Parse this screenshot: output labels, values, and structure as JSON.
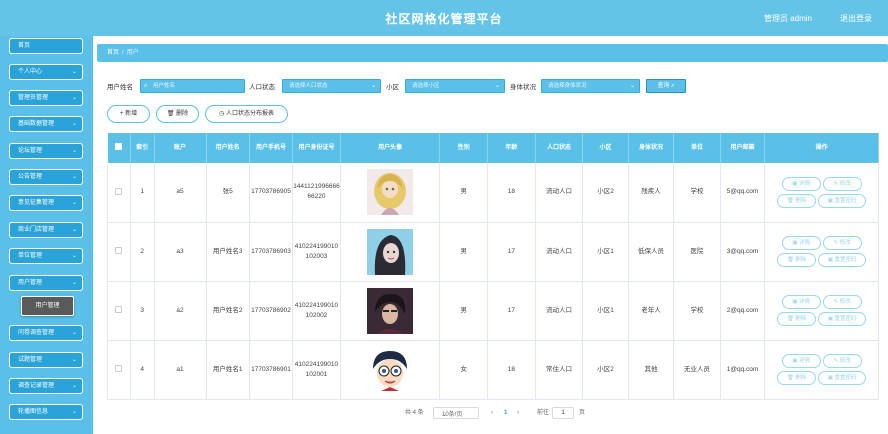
{
  "header": {
    "title": "社区网格化管理平台",
    "admin_label": "管理员 admin",
    "logout": "退出登录"
  },
  "sidebar": {
    "items": [
      "首页",
      "个人中心",
      "管理员管理",
      "基础数据管理",
      "论坛管理",
      "公告管理",
      "意见征集管理",
      "商业门店管理",
      "单位管理",
      "用户管理",
      "问卷调查管理",
      "试题管理",
      "调查记录管理",
      "轮播图信息"
    ],
    "submenu": "用户管理"
  },
  "breadcrumb": {
    "home": "首页",
    "sep": "/",
    "current": "用户"
  },
  "filters": {
    "name_label": "用户姓名",
    "name_placeholder": "用户姓名",
    "status_label": "人口状态",
    "status_placeholder": "请选择人口状态",
    "area_label": "小区",
    "area_placeholder": "请选择小区",
    "health_label": "身体状况",
    "health_placeholder": "请选择身体状况",
    "query": "查询"
  },
  "actions": {
    "add": "新增",
    "delete": "删除",
    "report": "人口状态分布报表"
  },
  "table": {
    "headers": [
      "索引",
      "账户",
      "用户姓名",
      "用户手机号",
      "用户身份证号",
      "用户头像",
      "性别",
      "年龄",
      "人口状态",
      "小区",
      "身体状况",
      "单位",
      "用户邮箱",
      "操作"
    ],
    "rows": [
      {
        "index": "1",
        "account": "a5",
        "name": "张5",
        "phone": "17703786905",
        "idcard": "144112199666666220",
        "gender": "男",
        "age": "18",
        "status": "流动人口",
        "area": "小区2",
        "health": "残疾人",
        "unit": "学校",
        "email": "5@qq.com",
        "avatar": "blonde-girl-avatar"
      },
      {
        "index": "2",
        "account": "a3",
        "name": "用户姓名3",
        "phone": "17703786903",
        "idcard": "410224199010102003",
        "gender": "男",
        "age": "17",
        "status": "流动人口",
        "area": "小区1",
        "health": "低保人员",
        "unit": "医院",
        "email": "3@qq.com",
        "avatar": "dark-hair-girl-avatar"
      },
      {
        "index": "3",
        "account": "a2",
        "name": "用户姓名2",
        "phone": "17703786902",
        "idcard": "410224199010102002",
        "gender": "男",
        "age": "17",
        "status": "流动人口",
        "area": "小区1",
        "health": "老年人",
        "unit": "学校",
        "email": "2@qq.com",
        "avatar": "boy-dark-avatar"
      },
      {
        "index": "4",
        "account": "a1",
        "name": "用户姓名1",
        "phone": "17703786901",
        "idcard": "410224199010102001",
        "gender": "女",
        "age": "18",
        "status": "常住人口",
        "area": "小区2",
        "health": "其他",
        "unit": "无业人员",
        "email": "1@qq.com",
        "avatar": "cartoon-boy-avatar"
      }
    ],
    "ops": {
      "detail": "详情",
      "edit": "修改",
      "delete": "删除",
      "reset": "重置密码"
    }
  },
  "pagination": {
    "total": "共 4 条",
    "page_size": "10条/页",
    "prev": "‹",
    "current_page": "1",
    "next": "›",
    "goto_label": "前往",
    "goto_value": "1",
    "page_suffix": "页"
  },
  "colors": {
    "header": "#63c4e8",
    "sidebar": "#5bc0e8",
    "menu_item": "#2aa3d8",
    "accent": "#5bc0e8"
  }
}
